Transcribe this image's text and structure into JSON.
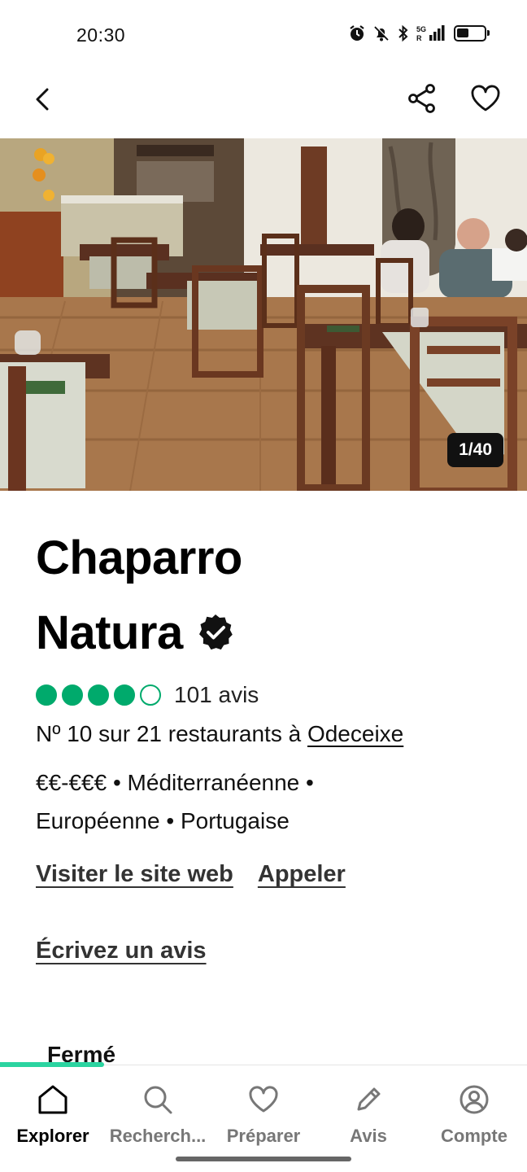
{
  "status_bar": {
    "time": "20:30",
    "network": "5G",
    "icons": [
      "alarm-icon",
      "bell-off-icon",
      "bluetooth-icon",
      "signal-icon",
      "battery-icon"
    ],
    "battery_level": 0.45
  },
  "app_bar": {
    "icons": [
      "back-arrow-icon",
      "share-icon",
      "heart-icon"
    ]
  },
  "photo": {
    "counter": "1/40",
    "current": 1,
    "total": 40
  },
  "restaurant": {
    "name_line1": "Chaparro",
    "name_line2": "Natura",
    "verified_icon": "verified-badge-icon",
    "rating": 4,
    "rating_max": 5,
    "rating_color": "#00aa6c",
    "reviews_count": "101 avis",
    "ranking_prefix": "Nº 10 sur 21 restaurants à",
    "ranking_location": "Odeceixe",
    "price": "€€-€€€",
    "cuisine_line1": " • Méditerranéenne •",
    "cuisine_line2": "Européenne • Portugaise"
  },
  "actions": {
    "website": "Visiter le site web",
    "call": "Appeler",
    "write_review": "Écrivez un avis"
  },
  "hours": {
    "status": "Fermé"
  },
  "bottom_nav": {
    "accent_color": "#2bd4a0",
    "items": [
      {
        "label": "Explorer",
        "icon": "home-icon",
        "active": true
      },
      {
        "label": "Recherch...",
        "icon": "search-icon",
        "active": false
      },
      {
        "label": "Préparer",
        "icon": "heart-icon",
        "active": false
      },
      {
        "label": "Avis",
        "icon": "pencil-icon",
        "active": false
      },
      {
        "label": "Compte",
        "icon": "account-icon",
        "active": false
      }
    ]
  }
}
